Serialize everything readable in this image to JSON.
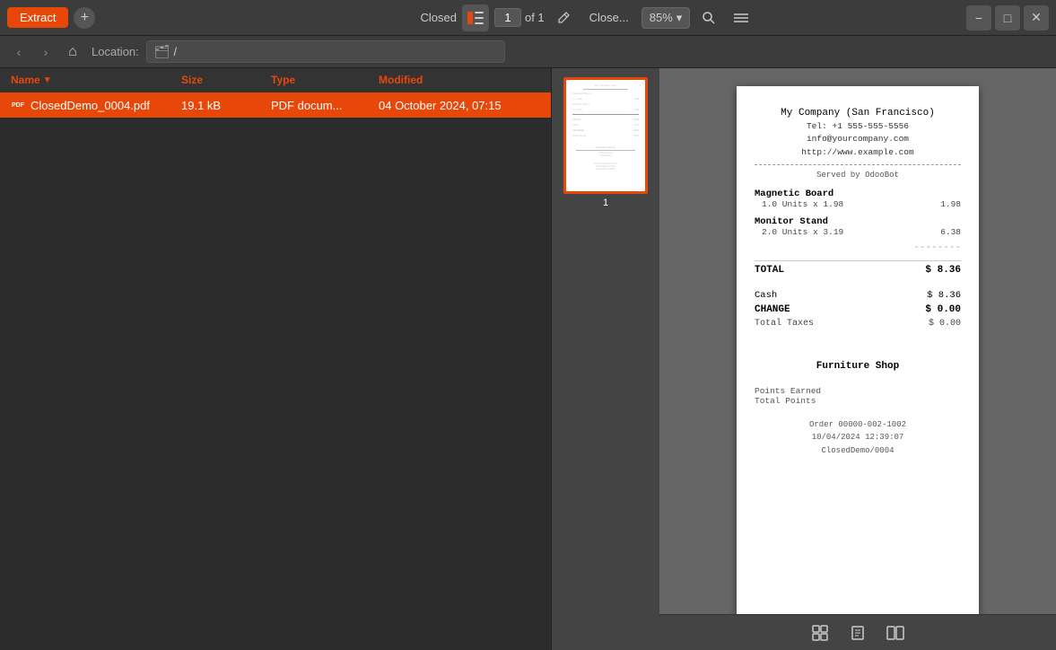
{
  "toolbar": {
    "extract_label": "Extract",
    "add_label": "+",
    "status": "Closed",
    "page_current": "1",
    "page_total": "of 1",
    "close_label": "Close...",
    "zoom_level": "85%",
    "minimize_icon": "−",
    "maximize_icon": "□",
    "close_icon": "✕"
  },
  "nav": {
    "location_label": "Location:",
    "location_path": "/",
    "back_label": "‹",
    "forward_label": "›",
    "home_label": "⌂"
  },
  "file_table": {
    "columns": [
      "Name",
      "Size",
      "Type",
      "Modified"
    ],
    "rows": [
      {
        "name": "ClosedDemo_0004.pdf",
        "size": "19.1 kB",
        "type": "PDF docum...",
        "modified": "04 October 2024, 07:15",
        "selected": true
      }
    ]
  },
  "pdf_viewer": {
    "thumbnail_page": "1",
    "document": {
      "company_name": "My Company (San Francisco)",
      "tel": "Tel: +1 555-555-5556",
      "email": "info@yourcompany.com",
      "website": "http://www.example.com",
      "served_by": "Served by OdooBot",
      "items": [
        {
          "name": "Magnetic Board",
          "detail": "1.0 Units x 1.98",
          "amount": "1.98"
        },
        {
          "name": "Monitor Stand",
          "detail": "2.0 Units x 3.19",
          "amount": "6.38"
        }
      ],
      "total_label": "TOTAL",
      "total_amount": "$ 8.36",
      "cash_label": "Cash",
      "cash_amount": "$ 8.36",
      "change_label": "CHANGE",
      "change_amount": "$ 0.00",
      "taxes_label": "Total Taxes",
      "taxes_amount": "$ 0.00",
      "section_title": "Furniture Shop",
      "loyalty_earned": "Points Earned",
      "loyalty_total": "Total Points",
      "order_number": "Order 00000-002-1002",
      "order_date": "10/04/2024 12:39:07",
      "order_ref": "ClosedDemo/0004"
    }
  },
  "bottom_toolbar": {
    "grid_icon": "⊞",
    "image_icon": "🖼",
    "book_icon": "📄"
  }
}
